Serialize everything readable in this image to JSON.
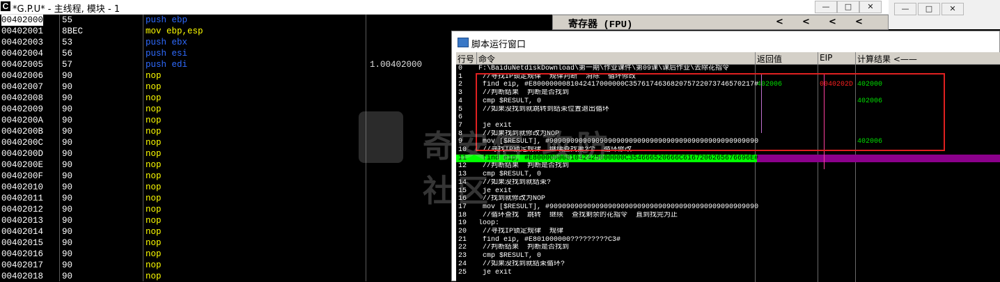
{
  "titlebar": {
    "app_icon": "C",
    "title": "*G.P.U* - 主线程, 模块 - 1",
    "min": "—",
    "max": "□",
    "close": "✕"
  },
  "register_panel": {
    "title": "寄存器 (FPU)",
    "arrows": [
      "<",
      "<",
      "<",
      "<"
    ]
  },
  "disasm_rows": [
    {
      "addr": "00402000",
      "bytes": "55",
      "asm": "push ebp",
      "asm_color": "blue",
      "comment": ""
    },
    {
      "addr": "00402001",
      "bytes": "8BEC",
      "asm": "mov ebp,esp",
      "asm_color": "yellow",
      "comment": ""
    },
    {
      "addr": "00402003",
      "bytes": "53",
      "asm": "push ebx",
      "asm_color": "blue",
      "comment": ""
    },
    {
      "addr": "00402004",
      "bytes": "56",
      "asm": "push esi",
      "asm_color": "blue",
      "comment": ""
    },
    {
      "addr": "00402005",
      "bytes": "57",
      "asm": "push edi",
      "asm_color": "blue",
      "comment": "1.00402000"
    },
    {
      "addr": "00402006",
      "bytes": "90",
      "asm": "nop",
      "asm_color": "yellow",
      "comment": ""
    },
    {
      "addr": "00402007",
      "bytes": "90",
      "asm": "nop",
      "asm_color": "yellow",
      "comment": ""
    },
    {
      "addr": "00402008",
      "bytes": "90",
      "asm": "nop",
      "asm_color": "yellow",
      "comment": ""
    },
    {
      "addr": "00402009",
      "bytes": "90",
      "asm": "nop",
      "asm_color": "yellow",
      "comment": ""
    },
    {
      "addr": "0040200A",
      "bytes": "90",
      "asm": "nop",
      "asm_color": "yellow",
      "comment": ""
    },
    {
      "addr": "0040200B",
      "bytes": "90",
      "asm": "nop",
      "asm_color": "yellow",
      "comment": ""
    },
    {
      "addr": "0040200C",
      "bytes": "90",
      "asm": "nop",
      "asm_color": "yellow",
      "comment": ""
    },
    {
      "addr": "0040200D",
      "bytes": "90",
      "asm": "nop",
      "asm_color": "yellow",
      "comment": ""
    },
    {
      "addr": "0040200E",
      "bytes": "90",
      "asm": "nop",
      "asm_color": "yellow",
      "comment": ""
    },
    {
      "addr": "0040200F",
      "bytes": "90",
      "asm": "nop",
      "asm_color": "yellow",
      "comment": ""
    },
    {
      "addr": "00402010",
      "bytes": "90",
      "asm": "nop",
      "asm_color": "yellow",
      "comment": ""
    },
    {
      "addr": "00402011",
      "bytes": "90",
      "asm": "nop",
      "asm_color": "yellow",
      "comment": ""
    },
    {
      "addr": "00402012",
      "bytes": "90",
      "asm": "nop",
      "asm_color": "yellow",
      "comment": ""
    },
    {
      "addr": "00402013",
      "bytes": "90",
      "asm": "nop",
      "asm_color": "yellow",
      "comment": ""
    },
    {
      "addr": "00402014",
      "bytes": "90",
      "asm": "nop",
      "asm_color": "yellow",
      "comment": ""
    },
    {
      "addr": "00402015",
      "bytes": "90",
      "asm": "nop",
      "asm_color": "yellow",
      "comment": ""
    },
    {
      "addr": "00402016",
      "bytes": "90",
      "asm": "nop",
      "asm_color": "yellow",
      "comment": ""
    },
    {
      "addr": "00402017",
      "bytes": "90",
      "asm": "nop",
      "asm_color": "yellow",
      "comment": ""
    },
    {
      "addr": "00402018",
      "bytes": "90",
      "asm": "nop",
      "asm_color": "yellow",
      "comment": ""
    }
  ],
  "script_window": {
    "title": "脚本运行窗口",
    "columns": {
      "line": "行号",
      "command": "命令",
      "return": "返回值",
      "eip": "EIP",
      "result": "计算结果 <——"
    },
    "lines": [
      {
        "n": "0",
        "cmd": "F:\\BaiduNetdiskDownload\\第一期\\作业课件\\第09课\\课后作业\\去除花指令",
        "color": "white",
        "rv": "",
        "eip": "",
        "res": ""
      },
      {
        "n": "1",
        "cmd": "//寻找IP锁定规律  规律判断  消除  循环修改",
        "color": "white",
        "rv": "",
        "eip": "",
        "res": ""
      },
      {
        "n": "2",
        "cmd": "find eip, #E8000000081042417000000C357617463682075722073746570217#",
        "color": "red",
        "rv": "402006",
        "eip": "0040202D",
        "res": "402000"
      },
      {
        "n": "3",
        "cmd": "//判断结果  判断是否找到",
        "color": "white",
        "rv": "",
        "eip": "",
        "res": ""
      },
      {
        "n": "4",
        "cmd": "cmp $RESULT, 0",
        "color": "red",
        "rv": "",
        "eip": "",
        "res": "402006"
      },
      {
        "n": "5",
        "cmd": "//如果没找到就跳转到结束位置退出循环",
        "color": "white",
        "rv": "",
        "eip": "",
        "res": ""
      },
      {
        "n": "6",
        "cmd": "",
        "color": "white",
        "rv": "",
        "eip": "",
        "res": ""
      },
      {
        "n": "7",
        "cmd": "je exit",
        "color": "red",
        "rv": "",
        "eip": "",
        "res": ""
      },
      {
        "n": "8",
        "cmd": "//如果找到就修改为NOP",
        "color": "white",
        "rv": "",
        "eip": "",
        "res": ""
      },
      {
        "n": "9",
        "cmd": "mov [$RESULT], #90909090909090909090909090909090909090909090909090#",
        "color": "red",
        "rv": "",
        "eip": "",
        "res": "402006"
      },
      {
        "n": "10",
        "cmd": "//寻找IP锁定规律  继续查找第2个  循环修改",
        "color": "white",
        "rv": "",
        "eip": "",
        "res": ""
      },
      {
        "n": "11",
        "cmd": "find eip, #E8000000081042425000000C354666520666C6167206265676696E#",
        "color": "black",
        "rv": "",
        "eip": "",
        "res": "",
        "highlight": true
      },
      {
        "n": "12",
        "cmd": "//判断结果  判断是否找到",
        "color": "white",
        "rv": "",
        "eip": "",
        "res": ""
      },
      {
        "n": "13",
        "cmd": "cmp $RESULT, 0",
        "color": "green",
        "rv": "",
        "eip": "",
        "res": ""
      },
      {
        "n": "14",
        "cmd": "//如果没找到就结束?",
        "color": "white",
        "rv": "",
        "eip": "",
        "res": ""
      },
      {
        "n": "15",
        "cmd": "je exit",
        "color": "green",
        "rv": "",
        "eip": "",
        "res": ""
      },
      {
        "n": "16",
        "cmd": "//找到就修改为NOP",
        "color": "white",
        "rv": "",
        "eip": "",
        "res": ""
      },
      {
        "n": "17",
        "cmd": "mov [$RESULT], #90909090909090909090909090909090909090909090909090#",
        "color": "green",
        "rv": "",
        "eip": "",
        "res": ""
      },
      {
        "n": "18",
        "cmd": "//循环查找  跳转  继续  查找剩余的花指令  直到找完为止",
        "color": "white",
        "rv": "",
        "eip": "",
        "res": ""
      },
      {
        "n": "19",
        "cmd": "loop:",
        "color": "white",
        "rv": "",
        "eip": "",
        "res": "",
        "outdent": true
      },
      {
        "n": "20",
        "cmd": "//寻找IP锁定规律  规律",
        "color": "white",
        "rv": "",
        "eip": "",
        "res": ""
      },
      {
        "n": "21",
        "cmd": "find eip, #E801000000?????????C3#",
        "color": "green",
        "rv": "",
        "eip": "",
        "res": ""
      },
      {
        "n": "22",
        "cmd": "//判断结果  判断是否找到",
        "color": "white",
        "rv": "",
        "eip": "",
        "res": ""
      },
      {
        "n": "23",
        "cmd": "cmp $RESULT, 0",
        "color": "green",
        "rv": "",
        "eip": "",
        "res": ""
      },
      {
        "n": "24",
        "cmd": "//如果没找到就结束循环?",
        "color": "white",
        "rv": "",
        "eip": "",
        "res": ""
      },
      {
        "n": "25",
        "cmd": "je exit",
        "color": "green",
        "rv": "",
        "eip": "",
        "res": ""
      }
    ]
  },
  "watermark": {
    "text": "奇安信 攻防社区"
  },
  "colors": {
    "highlight_row": "#00ff00",
    "annotation_box": "#e02020",
    "purple_bar": "#8b008b"
  }
}
